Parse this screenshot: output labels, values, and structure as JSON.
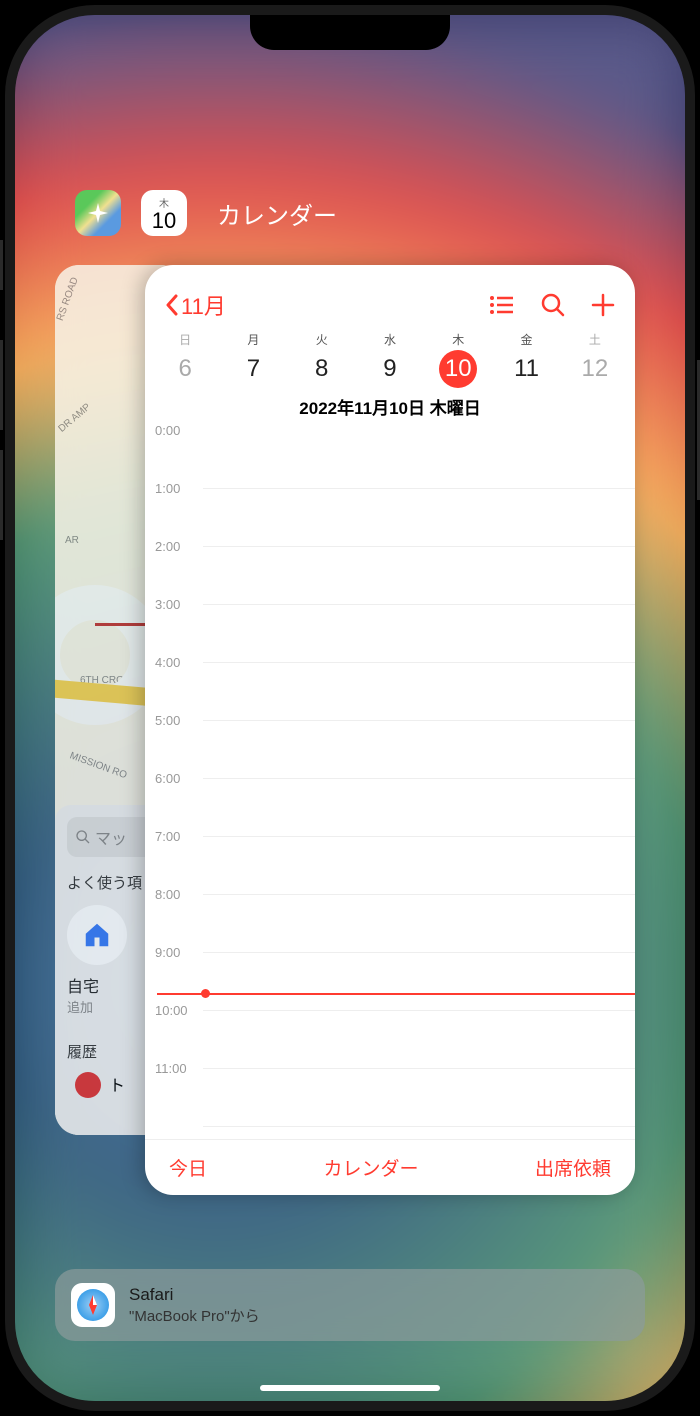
{
  "app_switcher": {
    "front_app_title": "カレンダー",
    "calendar_icon_day": "10",
    "calendar_icon_weekday": "木"
  },
  "maps": {
    "search_placeholder": "マッ",
    "favorites_title": "よく使う項",
    "home_label": "自宅",
    "home_sub": "追加",
    "history_label": "履歴",
    "pin_label": "ト",
    "road_labels": [
      "RS ROAD",
      "DR AMP",
      "AR",
      "6TH CRO",
      "MISSION RO"
    ]
  },
  "calendar": {
    "back_label": "11月",
    "week_days_jp": [
      "日",
      "月",
      "火",
      "水",
      "木",
      "金",
      "土"
    ],
    "week_days_num": [
      "6",
      "7",
      "8",
      "9",
      "10",
      "11",
      "12"
    ],
    "today_index": 4,
    "date_title": "2022年11月10日 木曜日",
    "hours": [
      "0:00",
      "1:00",
      "2:00",
      "3:00",
      "4:00",
      "5:00",
      "6:00",
      "7:00",
      "8:00",
      "9:00",
      "10:00",
      "11:00"
    ],
    "now_label": "9:41",
    "toolbar": {
      "today": "今日",
      "calendars": "カレンダー",
      "inbox": "出席依頼"
    }
  },
  "handoff": {
    "app": "Safari",
    "from": "\"MacBook Pro\"から"
  }
}
